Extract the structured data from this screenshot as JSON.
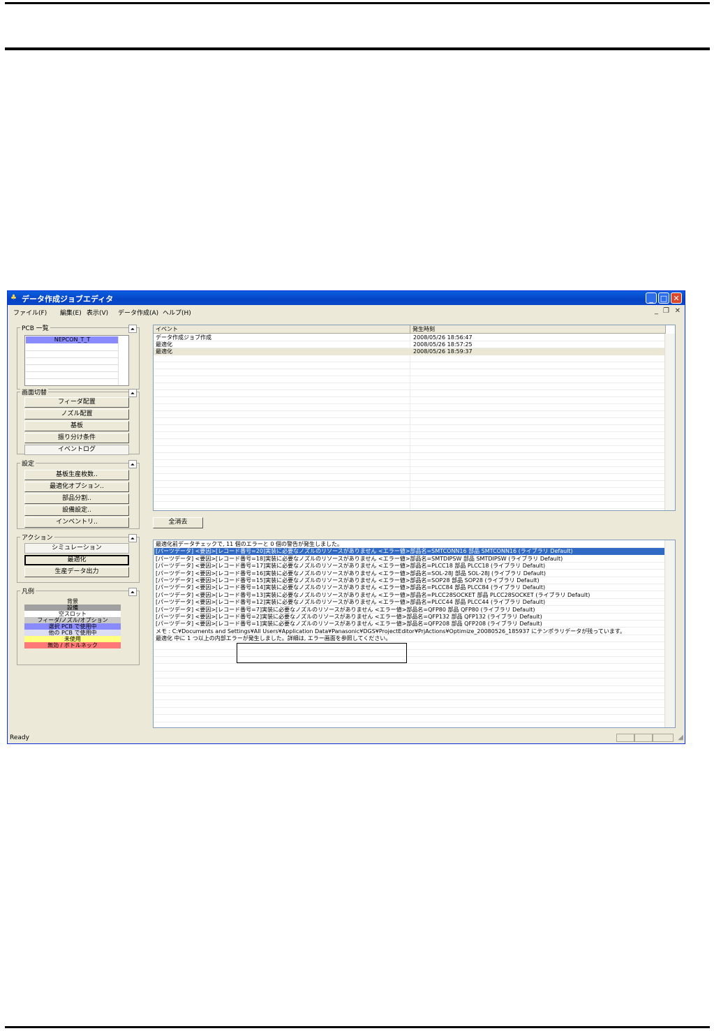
{
  "window": {
    "title": "データ作成ジョブエディタ",
    "status": "Ready"
  },
  "menu": [
    "ファイル(F)",
    "編集(E)",
    "表示(V)",
    "データ作成(A)",
    "ヘルプ(H)"
  ],
  "sidebar": {
    "pcb_list": {
      "label": "PCB 一覧",
      "items": [
        "NEPCON_T_T"
      ]
    },
    "screen_switch": {
      "label": "画面切替",
      "buttons": [
        "フィーダ配置",
        "ノズル配置",
        "基板",
        "振り分け条件",
        "イベントログ"
      ]
    },
    "settings": {
      "label": "設定",
      "buttons": [
        "基板生産枚数..",
        "最適化オプション..",
        "部品分割..",
        "設備設定..",
        "インベントリ.."
      ]
    },
    "actions": {
      "label": "アクション",
      "buttons": [
        "シミュレーション",
        "最適化",
        "生産データ出力"
      ]
    },
    "legend": {
      "label": "凡例",
      "items": [
        {
          "text": "背景",
          "color": "#ece9d8"
        },
        {
          "text": "設備",
          "color": "#a0a0a0"
        },
        {
          "text": "空スロット",
          "color": "#ffffff"
        },
        {
          "text": "フィーダ/ノズル/オプション",
          "color": "#c8c8c8"
        },
        {
          "text": "選択 PCB で使用中",
          "color": "#8a8aff"
        },
        {
          "text": "他の PCB で使用中",
          "color": "#dcdcf5"
        },
        {
          "text": "未使用",
          "color": "#ffff80"
        },
        {
          "text": "無効 / ボトルネック",
          "color": "#ff7878"
        }
      ]
    }
  },
  "event_table": {
    "columns": [
      "イベント",
      "発生時刻"
    ],
    "rows": [
      [
        "データ作成ジョブ作成",
        "2008/05/26 18:56:47"
      ],
      [
        "最適化",
        "2008/05/26 18:57:25"
      ],
      [
        "最適化",
        "2008/05/26 18:59:37"
      ]
    ]
  },
  "clear_button": "全消去",
  "log": {
    "lines": [
      "最適化前データチェックで, 11 個のエラーと 0 個の警告が発生しました。",
      "[パーツデータ] <要因>[レコード番号=20]実装に必要なノズルのリソースがありません <エラー値>部品名=SMTCONN16 部品 SMTCONN16 (ライブラリ Default)",
      "[パーツデータ] <要因>[レコード番号=18]実装に必要なノズルのリソースがありません <エラー値>部品名=SMTDIPSW 部品 SMTDIPSW (ライブラリ Default)",
      "[パーツデータ] <要因>[レコード番号=17]実装に必要なノズルのリソースがありません <エラー値>部品名=PLCC18 部品 PLCC18 (ライブラリ Default)",
      "[パーツデータ] <要因>[レコード番号=16]実装に必要なノズルのリソースがありません <エラー値>部品名=SOL-28J 部品 SOL-28J (ライブラリ Default)",
      "[パーツデータ] <要因>[レコード番号=15]実装に必要なノズルのリソースがありません <エラー値>部品名=SOP28 部品 SOP28 (ライブラリ Default)",
      "[パーツデータ] <要因>[レコード番号=14]実装に必要なノズルのリソースがありません <エラー値>部品名=PLCC84 部品 PLCC84 (ライブラリ Default)",
      "[パーツデータ] <要因>[レコード番号=13]実装に必要なノズルのリソースがありません <エラー値>部品名=PLCC28SOCKET 部品 PLCC28SOCKET (ライブラリ Default)",
      "[パーツデータ] <要因>[レコード番号=12]実装に必要なノズルのリソースがありません <エラー値>部品名=PLCC44 部品 PLCC44 (ライブラリ Default)",
      "[パーツデータ] <要因>[レコード番号=7]実装に必要なノズルのリソースがありません <エラー値>部品名=QFP80 部品 QFP80 (ライブラリ Default)",
      "[パーツデータ] <要因>[レコード番号=2]実装に必要なノズルのリソースがありません <エラー値>部品名=QFP132 部品 QFP132 (ライブラリ Default)",
      "[パーツデータ] <要因>[レコード番号=1]実装に必要なノズルのリソースがありません <エラー値>部品名=QFP208 部品 QFP208 (ライブラリ Default)",
      "メモ : C:¥Documents and Settings¥All Users¥Application Data¥Panasonic¥DGS¥ProjectEditor¥PrjActions¥Optimize_20080526_185937 にテンポラリデータが残っています。",
      "最適化 中に 1 つ以上の内部エラーが発生しました。詳細は, エラー画面を参照してください。"
    ],
    "selected_index": 1
  }
}
